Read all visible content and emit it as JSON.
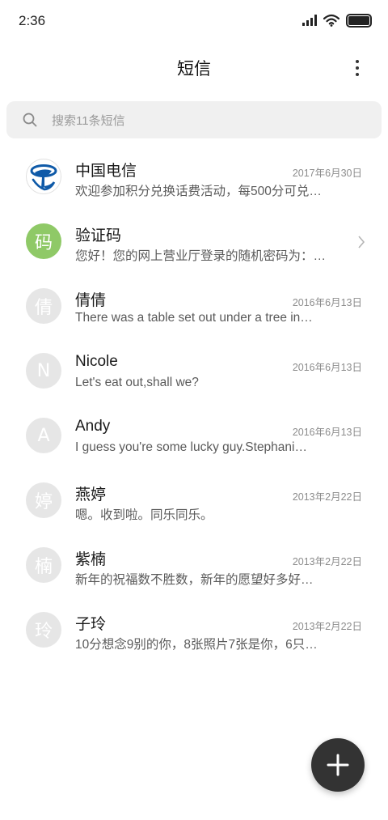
{
  "status_bar": {
    "time": "2:36",
    "icons": [
      "signal-icon",
      "wifi-icon",
      "battery-icon"
    ]
  },
  "header": {
    "title": "短信",
    "menu_icon": "more-vertical-icon"
  },
  "search": {
    "placeholder": "搜索11条短信",
    "icon": "search-icon"
  },
  "conversations": [
    {
      "name": "中国电信",
      "date": "2017年6月30日",
      "preview": "欢迎参加积分兑换话费活动，每500分可兑…",
      "avatar": "china-telecom-logo"
    },
    {
      "name": "验证码",
      "date": "",
      "preview": "您好！您的网上营业厅登录的随机密码为：…",
      "avatar_text": "码",
      "avatar_color": "#8fc967",
      "chevron": "chevron-right-icon"
    },
    {
      "name": "倩倩",
      "date": "2016年6月13日",
      "preview": "There was a table set out under a tree in…",
      "avatar_text": "倩"
    },
    {
      "name": "Nicole",
      "date": "2016年6月13日",
      "preview": "Let's eat out,shall we?",
      "avatar_text": "N"
    },
    {
      "name": "Andy",
      "date": "2016年6月13日",
      "preview": "I guess you're some lucky guy.Stephani…",
      "avatar_text": "A"
    },
    {
      "name": "燕婷",
      "date": "2013年2月22日",
      "preview": "嗯。收到啦。同乐同乐。",
      "avatar_text": "婷"
    },
    {
      "name": "紫楠",
      "date": "2013年2月22日",
      "preview": "新年的祝福数不胜数，新年的愿望好多好…",
      "avatar_text": "楠"
    },
    {
      "name": "子玲",
      "date": "2013年2月22日",
      "preview": "10分想念9别的你，8张照片7张是你，6只…",
      "avatar_text": "玲"
    }
  ],
  "fab": {
    "icon": "plus-icon"
  },
  "colors": {
    "background": "#ffffff",
    "search_bg": "#f0f0f0",
    "avatar_default": "#e6e6e6",
    "verify_avatar": "#8fc967",
    "fab": "#333333",
    "telecom_blue": "#0f5aa8"
  }
}
